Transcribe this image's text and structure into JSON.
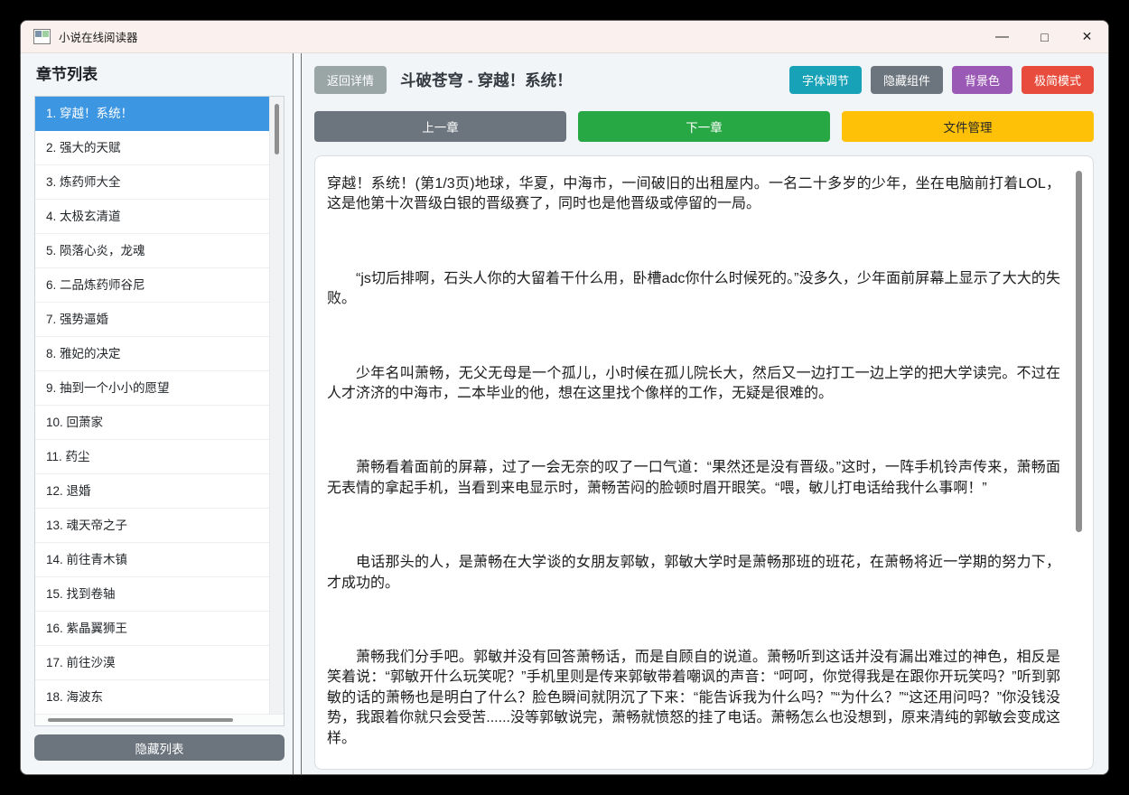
{
  "window": {
    "title": "小说在线阅读器",
    "controls": {
      "minimize": "—",
      "maximize": "□",
      "close": "✕"
    }
  },
  "sidebar": {
    "header": "章节列表",
    "chapters": [
      "1. 穿越！系统！",
      "2. 强大的天赋",
      "3. 炼药师大全",
      "4. 太极玄清道",
      "5. 陨落心炎，龙魂",
      "6. 二品炼药师谷尼",
      "7. 强势逼婚",
      "8. 雅妃的决定",
      "9. 抽到一个小小的愿望",
      "10. 回萧家",
      "11. 药尘",
      "12. 退婚",
      "13. 魂天帝之子",
      "14. 前往青木镇",
      "15. 找到卷轴",
      "16. 紫晶翼狮王",
      "17. 前往沙漠",
      "18. 海波东"
    ],
    "selected_chapter": "1. 穿越！系统！",
    "hide_list_button": "隐藏列表"
  },
  "header": {
    "back_button": "返回详情",
    "title": "斗破苍穹 - 穿越！系统！",
    "font_button": "字体调节",
    "hide_components_button": "隐藏组件",
    "background_button": "背景色",
    "minimal_button": "极简模式"
  },
  "nav": {
    "prev_button": "上一章",
    "next_button": "下一章",
    "files_button": "文件管理"
  },
  "reader": {
    "paragraphs": [
      "穿越！系统！(第1/3页)地球，华夏，中海市，一间破旧的出租屋内。一名二十多岁的少年，坐在电脑前打着LOL，这是他第十次晋级白银的晋级赛了，同时也是他晋级或停留的一局。",
      "“js切后排啊，石头人你的大留着干什么用，卧槽adc你什么时候死的。”没多久，少年面前屏幕上显示了大大的失败。",
      "少年名叫萧畅，无父无母是一个孤儿，小时候在孤儿院长大，然后又一边打工一边上学的把大学读完。不过在人才济济的中海市，二本毕业的他，想在这里找个像样的工作，无疑是很难的。",
      "萧畅看着面前的屏幕，过了一会无奈的叹了一口气道：“果然还是没有晋级。”这时，一阵手机铃声传来，萧畅面无表情的拿起手机，当看到来电显示时，萧畅苦闷的脸顿时眉开眼笑。“喂，敏儿打电话给我什么事啊！”",
      "电话那头的人，是萧畅在大学谈的女朋友郭敏，郭敏大学时是萧畅那班的班花，在萧畅将近一学期的努力下，才成功的。",
      "萧畅我们分手吧。郭敏并没有回答萧畅话，而是自顾自的说道。萧畅听到这话并没有漏出难过的神色，相反是笑着说：“郭敏开什么玩笑呢？”手机里则是传来郭敏带着嘲讽的声音：“呵呵，你觉得我是在跟你开玩笑吗？”听到郭敏的话的萧畅也是明白了什么？脸色瞬间就阴沉了下来：“能告诉我为什么吗？”“为什么？”“这还用问吗？”你没钱没势，我跟着你就只会受苦......没等郭敏说完，萧畅就愤怒的挂了电话。萧畅怎么也没想到，原来清纯的郭敏会变成这样。"
    ]
  },
  "colors": {
    "titlebar_bg": "#faf1ee",
    "selected_chapter_bg": "#3c96e2",
    "back_button": "#9aa5a6",
    "font_button": "#17a2b8",
    "hide_components_button": "#6c757d",
    "background_button": "#9b59b6",
    "minimal_button": "#e74c3c",
    "prev_button": "#6c757d",
    "next_button": "#28a745",
    "files_button": "#ffc107",
    "hide_list_button": "#6c757d"
  }
}
